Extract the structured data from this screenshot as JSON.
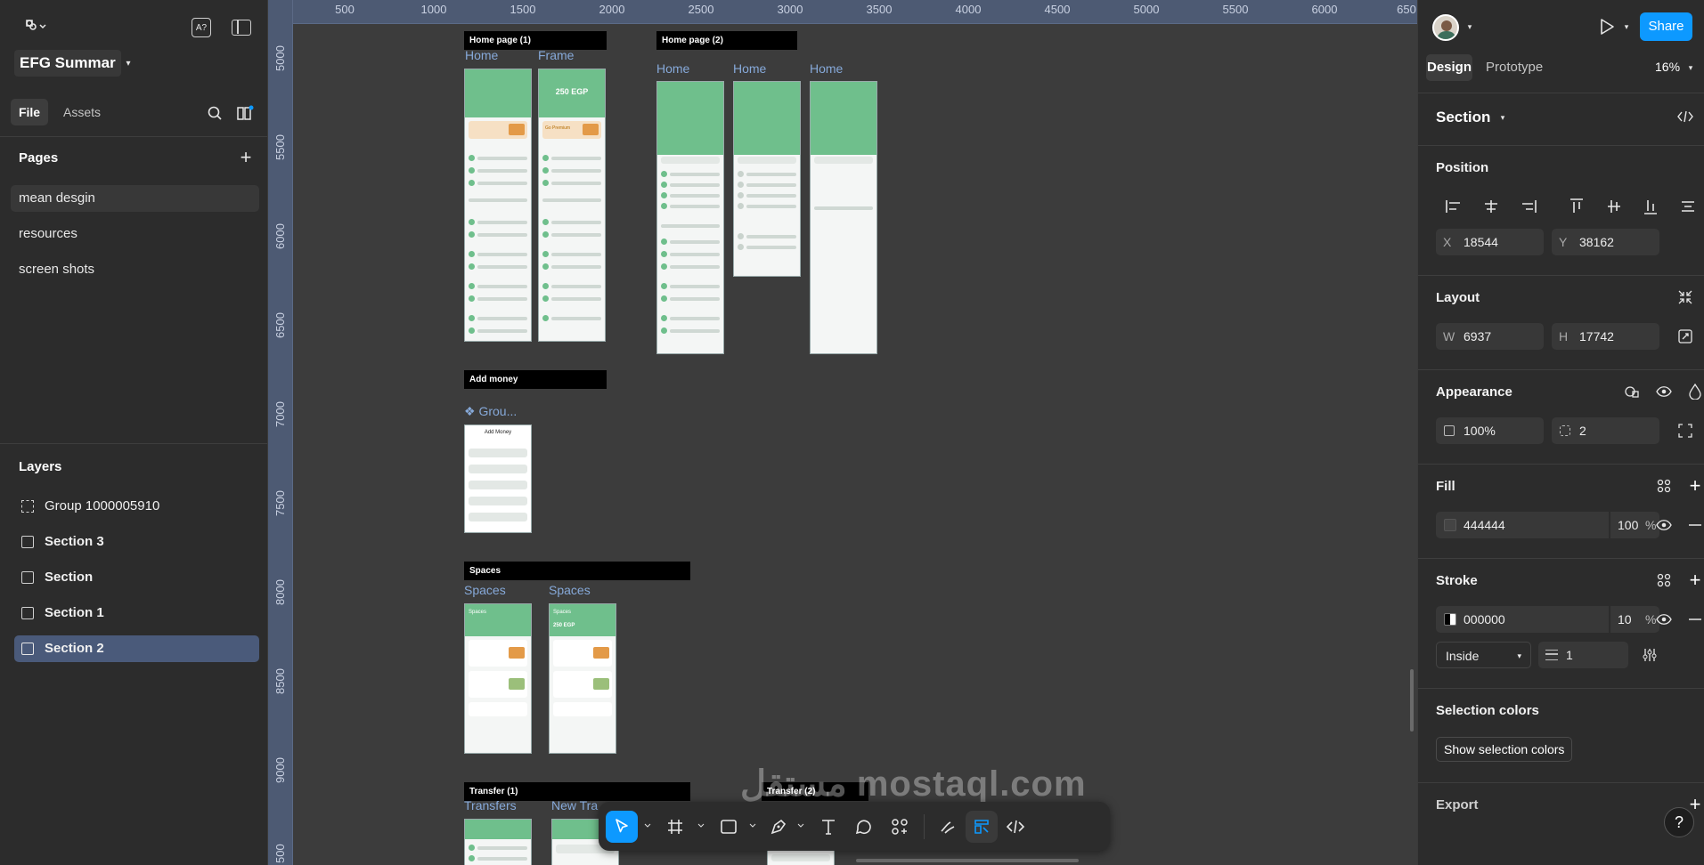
{
  "left_panel": {
    "file_name": "EFG Summar",
    "tabs": [
      "File",
      "Assets"
    ],
    "pages_title": "Pages",
    "pages": [
      "mean desgin",
      "resources",
      "screen shots"
    ],
    "layers_title": "Layers",
    "layers": [
      "Group 1000005910",
      "Section 3",
      "Section",
      "Section 1",
      "Section 2"
    ],
    "selected_layer": "Section 2"
  },
  "canvas": {
    "ruler_top": [
      "500",
      "1000",
      "1500",
      "2000",
      "2500",
      "3000",
      "3500",
      "4000",
      "4500",
      "5000",
      "5500",
      "6000",
      "650"
    ],
    "ruler_left": [
      "5000",
      "5500",
      "6000",
      "6500",
      "7000",
      "7500",
      "8000",
      "8500",
      "9000",
      "500"
    ],
    "sections": {
      "home1": "Home page (1)",
      "home2": "Home page (2)",
      "add_money": "Add money",
      "spaces": "Spaces",
      "transfer1": "Transfer (1)",
      "transfer2": "Transfer (2)"
    },
    "frame_labels": {
      "home": "Home",
      "frame": "Frame",
      "group": "❖ Grou...",
      "spaces": "Spaces",
      "transfers": "Transfers",
      "new_transfer": "New Tra"
    },
    "phone_texts": {
      "balance": "250 EGP",
      "go_premium": "Go Premium",
      "add_money_title": "Add Money",
      "spaces_title": "Spaces"
    },
    "watermark": "مستقل mostaql.com"
  },
  "right_panel": {
    "tabs": [
      "Design",
      "Prototype"
    ],
    "zoom": "16%",
    "share_label": "Share",
    "section_name": "Section",
    "position_title": "Position",
    "x": "18544",
    "y": "38162",
    "layout_title": "Layout",
    "w": "6937",
    "h": "17742",
    "appearance_title": "Appearance",
    "opacity": "100%",
    "radius": "2",
    "fill_title": "Fill",
    "fill_hex": "444444",
    "fill_opacity": "100",
    "stroke_title": "Stroke",
    "stroke_hex": "000000",
    "stroke_opacity": "10",
    "stroke_align": "Inside",
    "stroke_weight": "1",
    "selection_colors_title": "Selection colors",
    "show_selection_colors": "Show selection colors",
    "export_title": "Export",
    "percent": "%",
    "labels": {
      "x": "X",
      "y": "Y",
      "w": "W",
      "h": "H"
    }
  },
  "colors": {
    "accent": "#0d99ff",
    "selected_layer_bg": "#4a5a7a",
    "phone_green": "#6fbf8c",
    "fill": "#444444",
    "stroke": "#000000"
  }
}
